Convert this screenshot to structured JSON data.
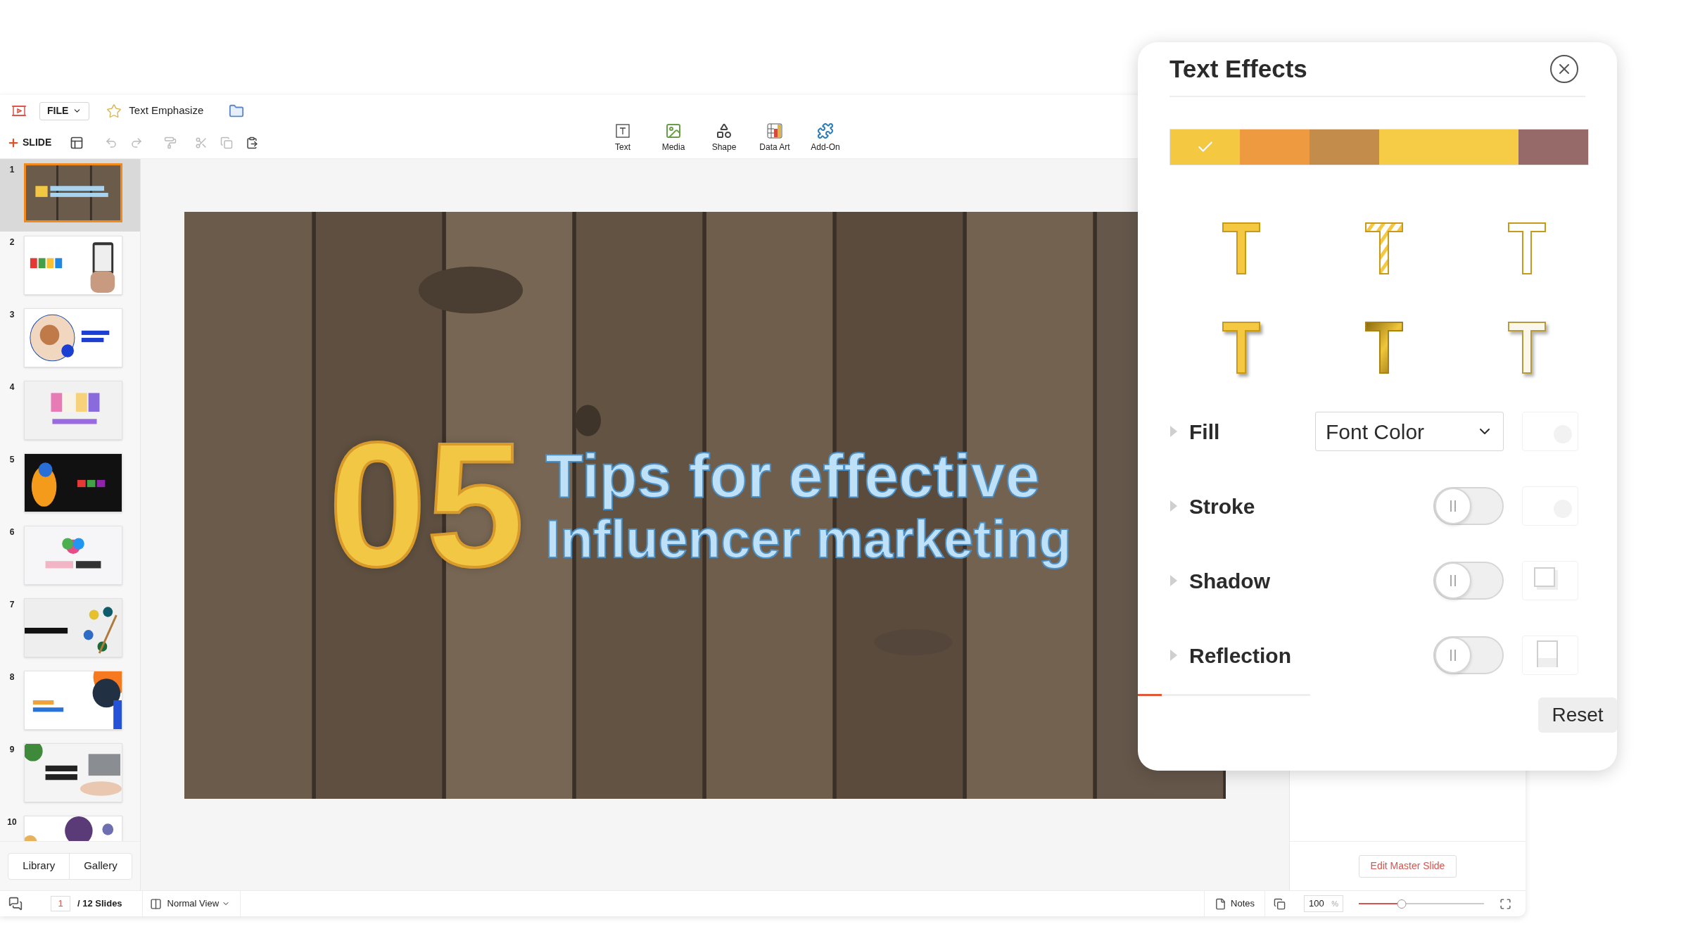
{
  "app_bar": {
    "file_menu": "FILE",
    "document_title": "Text Emphasize"
  },
  "toolbar": {
    "new_slide": "SLIDE"
  },
  "insert_tools": [
    {
      "label": "Text",
      "kind": "text"
    },
    {
      "label": "Media",
      "kind": "media"
    },
    {
      "label": "Shape",
      "kind": "shape"
    },
    {
      "label": "Data Art",
      "kind": "data-art"
    },
    {
      "label": "Add-On",
      "kind": "add-on"
    }
  ],
  "slides": [
    {
      "number": "1",
      "selected": true
    },
    {
      "number": "2",
      "selected": false
    },
    {
      "number": "3",
      "selected": false
    },
    {
      "number": "4",
      "selected": false
    },
    {
      "number": "5",
      "selected": false
    },
    {
      "number": "6",
      "selected": false
    },
    {
      "number": "7",
      "selected": false
    },
    {
      "number": "8",
      "selected": false
    },
    {
      "number": "9",
      "selected": false
    },
    {
      "number": "10",
      "selected": false
    }
  ],
  "panel_tabs": [
    "Library",
    "Gallery"
  ],
  "slide": {
    "number": "05",
    "line_1": "Tips for effective",
    "line_2": "Influencer marketing"
  },
  "text_effects": {
    "title": "Text Effects",
    "swatches": [
      {
        "color": "#f5c842",
        "selected": true
      },
      {
        "color": "#ee9a40",
        "selected": false
      },
      {
        "color": "#c48c4a",
        "selected": false
      },
      {
        "color": "#f6cb45",
        "selected": false
      },
      {
        "color": "#f6cb45",
        "selected": false
      },
      {
        "color": "#976a6a",
        "selected": false
      }
    ],
    "presets": [
      {
        "kind": "solid"
      },
      {
        "kind": "striped"
      },
      {
        "kind": "outline"
      },
      {
        "kind": "solid-shadow"
      },
      {
        "kind": "gradient"
      },
      {
        "kind": "outline-shadow"
      }
    ],
    "rows": [
      {
        "label": "Fill",
        "kind": "dropdown",
        "value": "Font Color",
        "preview": {
          "kind": "color"
        }
      },
      {
        "label": "Stroke",
        "kind": "toggle",
        "on": false,
        "preview": {
          "kind": "color"
        }
      },
      {
        "label": "Shadow",
        "kind": "toggle",
        "on": false,
        "preview": {
          "kind": "shadow"
        }
      },
      {
        "label": "Reflection",
        "kind": "toggle",
        "on": false,
        "preview": {
          "kind": "reflection"
        }
      }
    ],
    "reset": "Reset"
  },
  "right_panel": {
    "edit_master": "Edit Master Slide"
  },
  "status_bar": {
    "page": "1",
    "total": "/ 12 Slides",
    "view": "Normal View",
    "notes": "Notes",
    "zoom": "100",
    "zoom_unit": "%",
    "zoom_slider": {
      "level": 0.34
    }
  }
}
